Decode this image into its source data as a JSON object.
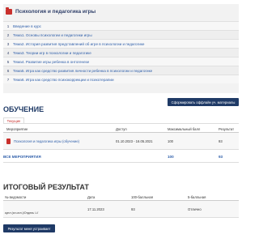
{
  "course": {
    "title": "Психология и педагогика игры",
    "lessons": [
      {
        "num": "1",
        "title": "Введение в курс"
      },
      {
        "num": "2",
        "title": "Тема1. Основы психологии и педагогики игры"
      },
      {
        "num": "3",
        "title": "Тема2. История развития представлений об игре в психологии и педагогике"
      },
      {
        "num": "4",
        "title": "Тема3. Теории игр в психологии и педагогике"
      },
      {
        "num": "5",
        "title": "Тема4. Развитие игры ребенка в онтогенезе"
      },
      {
        "num": "6",
        "title": "Тема5. Игра как средство развития личности ребенка в психологии и педагогике"
      },
      {
        "num": "7",
        "title": "Тема6. Игра как средство психокоррекции и психотерапии"
      }
    ]
  },
  "report_button": "Сформировать оффлайн уч. материалы",
  "study": {
    "title": "ОБУЧЕНИЕ",
    "tab": "Текущие",
    "columns": [
      "Мероприятие",
      "Доступ",
      "Максимальный балл",
      "Результат"
    ],
    "row": {
      "name": "Психология и педагогика игры (обучение)",
      "access": "01.10.2023 - 16.05.2021",
      "max_score": "100",
      "result": "93"
    },
    "total": {
      "label": "ВСЕ МЕРОПРИЯТИЯ",
      "max_score": "100",
      "result": "93"
    }
  },
  "final": {
    "title": "ИТОГОВЫЙ РЕЗУЛЬТАТ",
    "columns": [
      "№ ведомости",
      "Дата",
      "100-балльная",
      "5-балльная"
    ],
    "row": {
      "number": "купл (эл.онл.)/Отдель /-//",
      "date": "17.11.2023",
      "score100": "93",
      "score5": "Отлично"
    },
    "button": "Результат меня устраивает"
  },
  "colors": {
    "accent_red": "#c9302c",
    "navy": "#1f3a66",
    "link_blue": "#2f5faa"
  }
}
